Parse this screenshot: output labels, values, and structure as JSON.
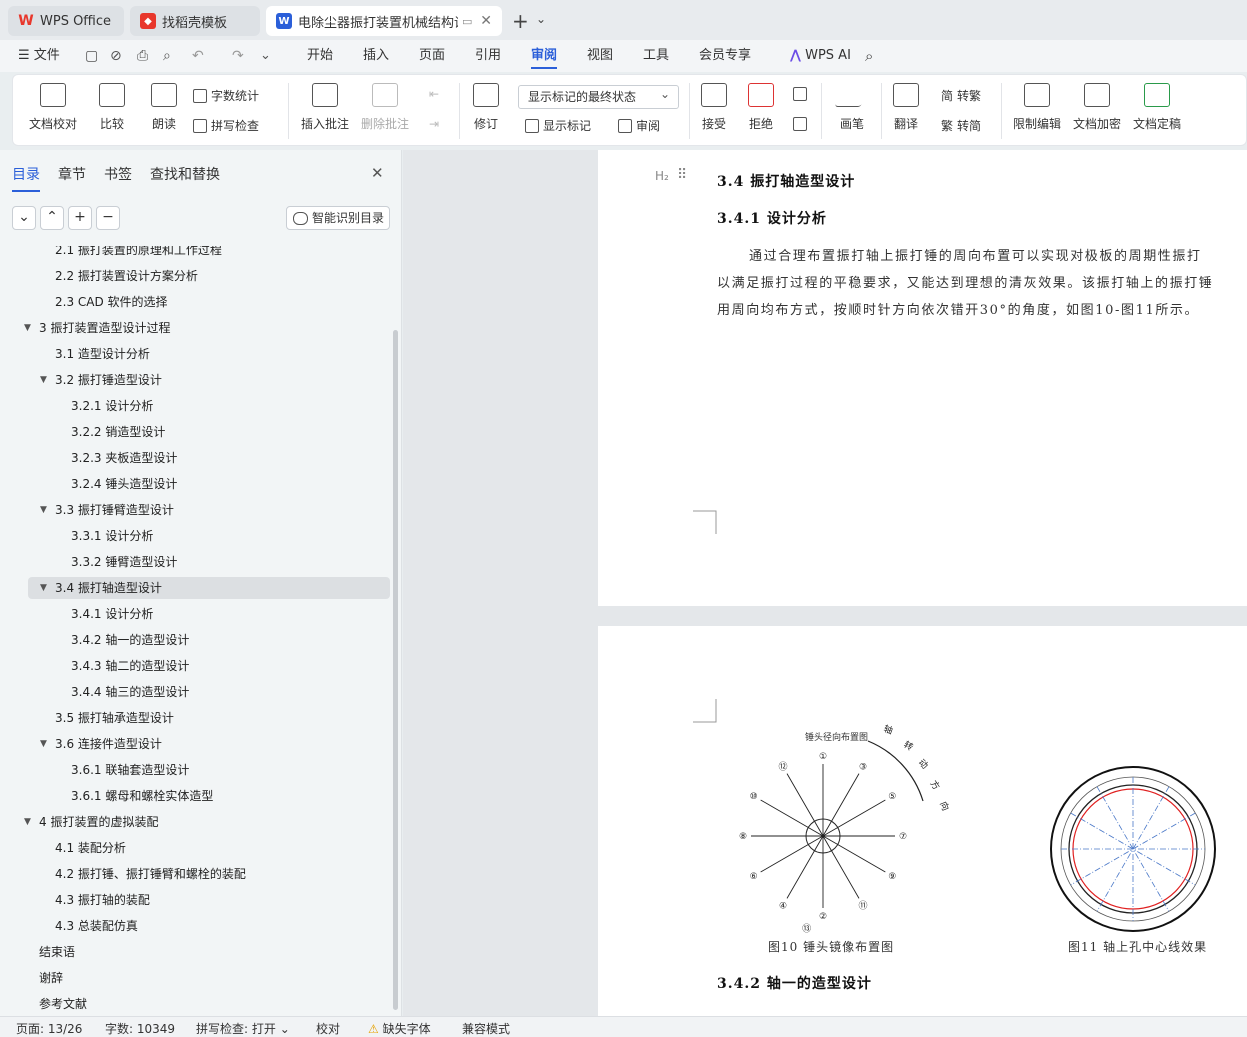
{
  "tabs": [
    {
      "label": "WPS Office"
    },
    {
      "label": "找稻壳模板"
    },
    {
      "label": "电除尘器振打装置机械结构设"
    }
  ],
  "menu": {
    "file": "文件",
    "items": [
      "开始",
      "插入",
      "页面",
      "引用",
      "审阅",
      "视图",
      "工具",
      "会员专享"
    ],
    "ai": "WPS AI"
  },
  "ribbon": {
    "doc_check": "文档校对",
    "compare": "比较",
    "read_aloud": "朗读",
    "word_count": "字数统计",
    "spell_check": "拼写检查",
    "insert_comment": "插入批注",
    "delete_comment": "删除批注",
    "revise": "修订",
    "markup_state": "显示标记的最终状态",
    "show_markup": "显示标记",
    "review": "审阅",
    "accept": "接受",
    "reject": "拒绝",
    "pen": "画笔",
    "translate": "翻译",
    "to_traditional": "转繁",
    "to_simplified": "转简",
    "restrict_edit": "限制编辑",
    "encrypt": "文档加密",
    "finalize": "文档定稿"
  },
  "sidebar": {
    "tabs": [
      "目录",
      "章节",
      "书签",
      "查找和替换"
    ],
    "smart_toc": "智能识别目录",
    "toc": [
      {
        "label": "2.1 振打装置的原理和工作过程",
        "level": 2
      },
      {
        "label": "2.2 振打装置设计方案分析",
        "level": 2
      },
      {
        "label": "2.3 CAD 软件的选择",
        "level": 2
      },
      {
        "label": "3 振打装置造型设计过程",
        "level": 1,
        "expanded": true
      },
      {
        "label": "3.1 造型设计分析",
        "level": 2
      },
      {
        "label": "3.2 振打锤造型设计",
        "level": 2,
        "expanded": true
      },
      {
        "label": "3.2.1 设计分析",
        "level": 3
      },
      {
        "label": "3.2.2 销造型设计",
        "level": 3
      },
      {
        "label": "3.2.3 夹板造型设计",
        "level": 3
      },
      {
        "label": "3.2.4 锤头造型设计",
        "level": 3
      },
      {
        "label": "3.3 振打锤臂造型设计",
        "level": 2,
        "expanded": true
      },
      {
        "label": "3.3.1 设计分析",
        "level": 3
      },
      {
        "label": "3.3.2 锤臂造型设计",
        "level": 3
      },
      {
        "label": "3.4 振打轴造型设计",
        "level": 2,
        "expanded": true,
        "selected": true
      },
      {
        "label": "3.4.1 设计分析",
        "level": 3
      },
      {
        "label": "3.4.2 轴一的造型设计",
        "level": 3
      },
      {
        "label": "3.4.3 轴二的造型设计",
        "level": 3
      },
      {
        "label": "3.4.4 轴三的造型设计",
        "level": 3
      },
      {
        "label": "3.5 振打轴承造型设计",
        "level": 2
      },
      {
        "label": "3.6 连接件造型设计",
        "level": 2,
        "expanded": true
      },
      {
        "label": "3.6.1 联轴套造型设计",
        "level": 3
      },
      {
        "label": "3.6.1 螺母和螺栓实体造型",
        "level": 3
      },
      {
        "label": "4 振打装置的虚拟装配",
        "level": 1,
        "expanded": true
      },
      {
        "label": "4.1 装配分析",
        "level": 2
      },
      {
        "label": "4.2 振打锤、振打锤臂和螺栓的装配",
        "level": 2
      },
      {
        "label": "4.3 振打轴的装配",
        "level": 2
      },
      {
        "label": "4.3 总装配仿真",
        "level": 2
      },
      {
        "label": "结束语",
        "level": 1
      },
      {
        "label": "谢辞",
        "level": 1
      },
      {
        "label": "参考文献",
        "level": 1
      }
    ]
  },
  "document": {
    "heading_marker": "H₂",
    "h_34": "3.4 振打轴造型设计",
    "h_341": "3.4.1 设计分析",
    "para_lines": [
      "通过合理布置振打轴上振打锤的周向布置可以实现对极板的周期性振打",
      "以满足振打过程的平稳要求，又能达到理想的清灰效果。该振打轴上的振打锤",
      "用周向均布方式，按顺时针方向依次错开30°的角度，如图10-图11所示。"
    ],
    "fig10_title": "锤头径向布置图",
    "fig10_rotation": [
      "轴",
      "转",
      "动",
      "方",
      "向"
    ],
    "fig10_numbers": [
      "①",
      "②",
      "③",
      "④",
      "⑤",
      "⑥",
      "⑦",
      "⑧",
      "⑨",
      "⑩",
      "⑪",
      "⑫",
      "⑬"
    ],
    "fig10_caption": "图10 锤头镜像布置图",
    "fig11_caption": "图11 轴上孔中心线效果",
    "h_342": "3.4.2 轴一的造型设计"
  },
  "status": {
    "page": "页面: 13/26",
    "words": "字数: 10349",
    "spell": "拼写检查: 打开",
    "proof": "校对",
    "missing_font": "缺失字体",
    "compat": "兼容模式"
  },
  "colors": {
    "accent": "#2b5fd9",
    "wps_red": "#e8372c",
    "word_blue": "#2b5fd9"
  }
}
